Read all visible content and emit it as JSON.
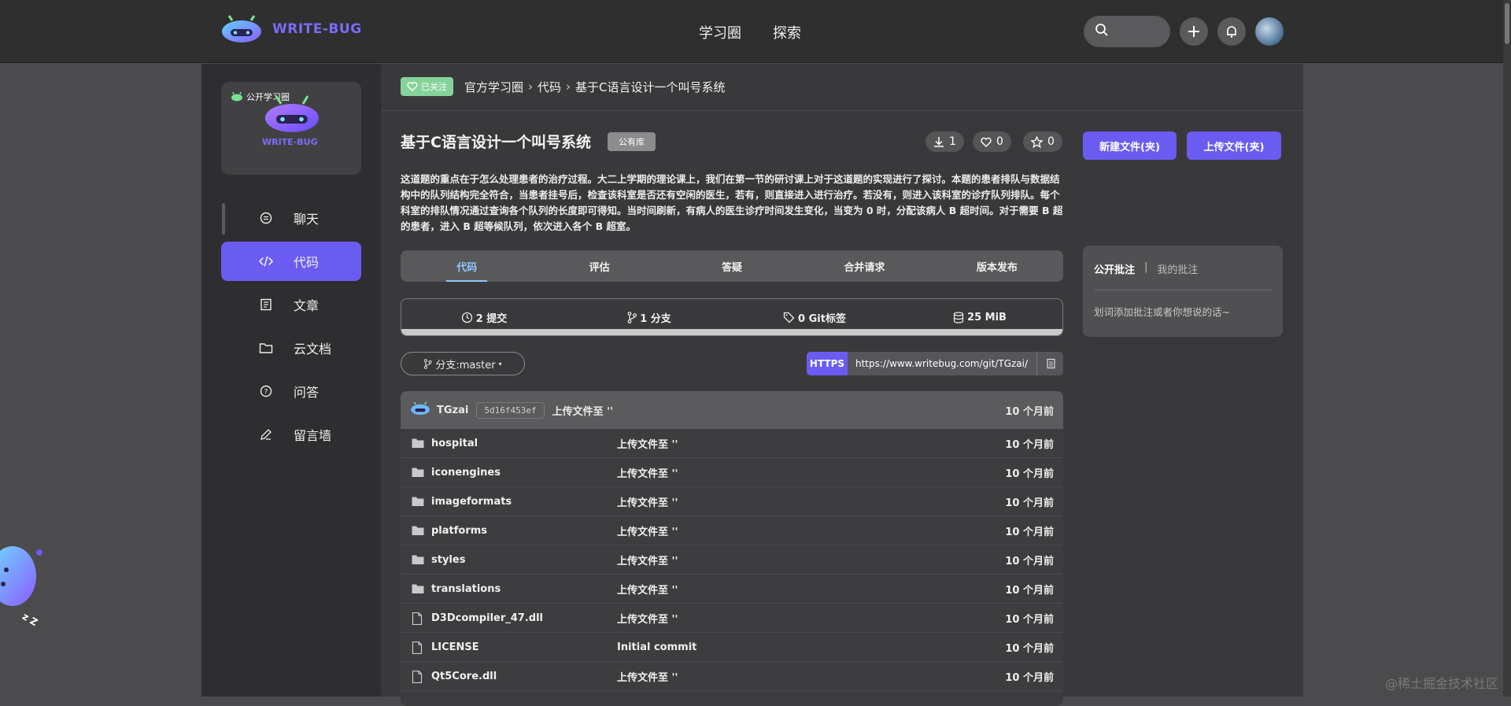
{
  "topbar": {
    "brand": "WRITE-BUG",
    "nav": [
      "学习圈",
      "探索"
    ],
    "icons": [
      "search-icon",
      "plus-icon",
      "bell-icon",
      "avatar"
    ]
  },
  "sidebar": {
    "group_tag": "公开学习圈",
    "group_brand": "WRITE-BUG",
    "items": [
      {
        "label": "聊天",
        "icon": "chat-icon",
        "active": false
      },
      {
        "label": "代码",
        "icon": "code-icon",
        "active": true
      },
      {
        "label": "文章",
        "icon": "article-icon",
        "active": false
      },
      {
        "label": "云文档",
        "icon": "folder-icon",
        "active": false
      },
      {
        "label": "问答",
        "icon": "question-icon",
        "active": false
      },
      {
        "label": "留言墙",
        "icon": "edit-icon",
        "active": false
      }
    ]
  },
  "breadcrumb": {
    "follow": "已关注",
    "items": [
      "官方学习圈",
      "代码",
      "基于C语言设计一个叫号系统"
    ]
  },
  "repo": {
    "title": "基于C语言设计一个叫号系统",
    "visibility": "公有库",
    "downloads": "1",
    "likes": "0",
    "stars": "0",
    "new_file_btn": "新建文件(夹)",
    "upload_btn": "上传文件(夹)",
    "description": "这道题的重点在于怎么处理患者的治疗过程。大二上学期的理论课上，我们在第一节的研讨课上对于这道题的实现进行了探讨。本题的患者排队与数据结构中的队列结构完全符合，当患者挂号后，检查该科室是否还有空闲的医生，若有，则直接进入进行治疗。若没有，则进入该科室的诊疗队列排队。每个科室的排队情况通过查询各个队列的长度即可得知。当时间刷新，有病人的医生诊疗时间发生变化，当变为 0 时，分配该病人 B 超时间。对于需要 B 超的患者，进入 B 超等候队列，依次进入各个 B 超室。"
  },
  "tabs": [
    {
      "label": "代码",
      "active": true
    },
    {
      "label": "评估",
      "active": false
    },
    {
      "label": "答疑",
      "active": false
    },
    {
      "label": "合并请求",
      "active": false
    },
    {
      "label": "版本发布",
      "active": false
    }
  ],
  "stats": {
    "commits": "2 提交",
    "branches": "1 分支",
    "tags": "0 Git标签",
    "size": "25 MiB"
  },
  "branch_selector": "分支:master",
  "clone": {
    "protocol": "HTTPS",
    "url": "https://www.writebug.com/git/TGzai/"
  },
  "latest_commit": {
    "author": "TGzai",
    "hash": "5d16f453ef",
    "message": "上传文件至 ''",
    "time": "10 个月前"
  },
  "files": [
    {
      "name": "hospital",
      "type": "folder",
      "message": "上传文件至 ''",
      "time": "10 个月前"
    },
    {
      "name": "iconengines",
      "type": "folder",
      "message": "上传文件至 ''",
      "time": "10 个月前"
    },
    {
      "name": "imageformats",
      "type": "folder",
      "message": "上传文件至 ''",
      "time": "10 个月前"
    },
    {
      "name": "platforms",
      "type": "folder",
      "message": "上传文件至 ''",
      "time": "10 个月前"
    },
    {
      "name": "styles",
      "type": "folder",
      "message": "上传文件至 ''",
      "time": "10 个月前"
    },
    {
      "name": "translations",
      "type": "folder",
      "message": "上传文件至 ''",
      "time": "10 个月前"
    },
    {
      "name": "D3Dcompiler_47.dll",
      "type": "file",
      "message": "上传文件至 ''",
      "time": "10 个月前"
    },
    {
      "name": "LICENSE",
      "type": "file",
      "message": "Initial commit",
      "time": "10 个月前"
    },
    {
      "name": "Qt5Core.dll",
      "type": "file",
      "message": "上传文件至 ''",
      "time": "10 个月前"
    }
  ],
  "annotations": {
    "tab_public": "公开批注",
    "separator": "|",
    "tab_mine": "我的批注",
    "hint": "划词添加批注或者你想说的话~"
  },
  "watermark": "@稀土掘金技术社区",
  "mascot_text": "z Z"
}
